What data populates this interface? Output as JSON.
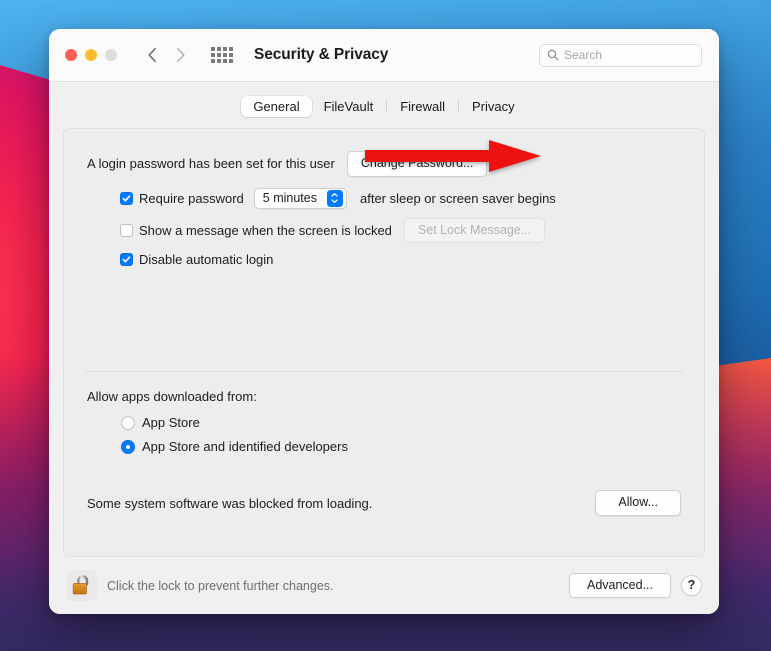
{
  "window": {
    "title": "Security & Privacy",
    "traffic_lights": [
      "close",
      "minimize",
      "zoom"
    ],
    "nav_back": "back-arrow",
    "nav_forward": "forward-arrow",
    "grid_button": "show-all-preferences",
    "search": {
      "placeholder": "Search",
      "value": "",
      "icon": "search-icon"
    }
  },
  "tabs": [
    {
      "label": "General",
      "active": true
    },
    {
      "label": "FileVault",
      "active": false
    },
    {
      "label": "Firewall",
      "active": false
    },
    {
      "label": "Privacy",
      "active": false
    }
  ],
  "general": {
    "password_status": "A login password has been set for this user",
    "change_password_button": "Change Password...",
    "require_password": {
      "label": "Require password",
      "checked": true,
      "interval": "5 minutes",
      "suffix": "after sleep or screen saver begins"
    },
    "show_message": {
      "label": "Show a message when the screen is locked",
      "checked": false,
      "button": "Set Lock Message...",
      "button_disabled": true
    },
    "disable_auto_login": {
      "label": "Disable automatic login",
      "checked": true
    }
  },
  "allow_apps": {
    "heading": "Allow apps downloaded from:",
    "options": [
      {
        "label": "App Store",
        "selected": false
      },
      {
        "label": "App Store and identified developers",
        "selected": true
      }
    ]
  },
  "blocked_software": {
    "message": "Some system software was blocked from loading.",
    "allow_button": "Allow...",
    "annotation": {
      "type": "arrow",
      "direction": "right",
      "color": "#ee1111",
      "points_to": "allow-button"
    }
  },
  "footer": {
    "lock_icon": "unlocked-padlock-icon",
    "lock_text": "Click the lock to prevent further changes.",
    "advanced_button": "Advanced...",
    "help_button": "?"
  },
  "colors": {
    "accent": "#007aff",
    "annotation_red": "#ee1111",
    "window_bg": "#f0f0f0",
    "titlebar_bg": "#fbfbfb"
  }
}
